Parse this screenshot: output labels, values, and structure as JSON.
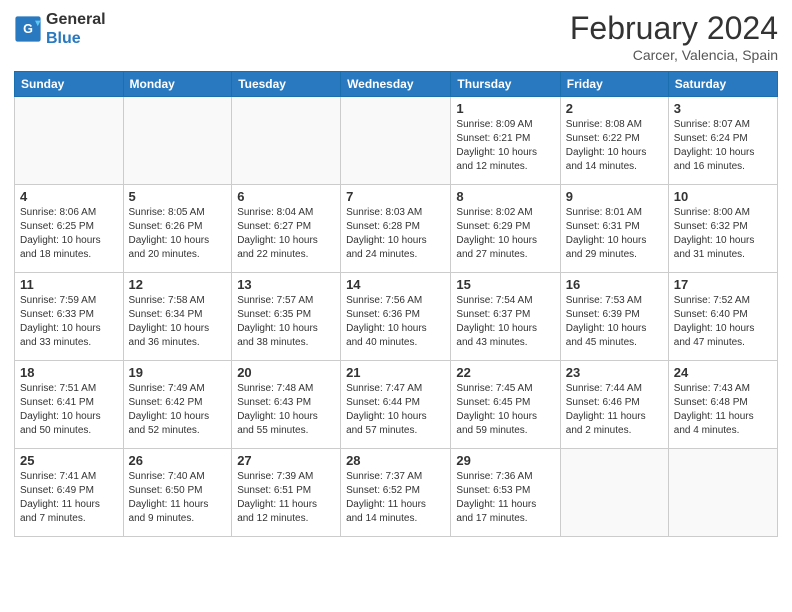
{
  "header": {
    "logo_line1": "General",
    "logo_line2": "Blue",
    "title": "February 2024",
    "subtitle": "Carcer, Valencia, Spain"
  },
  "days_of_week": [
    "Sunday",
    "Monday",
    "Tuesday",
    "Wednesday",
    "Thursday",
    "Friday",
    "Saturday"
  ],
  "weeks": [
    [
      {
        "day": "",
        "info": ""
      },
      {
        "day": "",
        "info": ""
      },
      {
        "day": "",
        "info": ""
      },
      {
        "day": "",
        "info": ""
      },
      {
        "day": "1",
        "info": "Sunrise: 8:09 AM\nSunset: 6:21 PM\nDaylight: 10 hours\nand 12 minutes."
      },
      {
        "day": "2",
        "info": "Sunrise: 8:08 AM\nSunset: 6:22 PM\nDaylight: 10 hours\nand 14 minutes."
      },
      {
        "day": "3",
        "info": "Sunrise: 8:07 AM\nSunset: 6:24 PM\nDaylight: 10 hours\nand 16 minutes."
      }
    ],
    [
      {
        "day": "4",
        "info": "Sunrise: 8:06 AM\nSunset: 6:25 PM\nDaylight: 10 hours\nand 18 minutes."
      },
      {
        "day": "5",
        "info": "Sunrise: 8:05 AM\nSunset: 6:26 PM\nDaylight: 10 hours\nand 20 minutes."
      },
      {
        "day": "6",
        "info": "Sunrise: 8:04 AM\nSunset: 6:27 PM\nDaylight: 10 hours\nand 22 minutes."
      },
      {
        "day": "7",
        "info": "Sunrise: 8:03 AM\nSunset: 6:28 PM\nDaylight: 10 hours\nand 24 minutes."
      },
      {
        "day": "8",
        "info": "Sunrise: 8:02 AM\nSunset: 6:29 PM\nDaylight: 10 hours\nand 27 minutes."
      },
      {
        "day": "9",
        "info": "Sunrise: 8:01 AM\nSunset: 6:31 PM\nDaylight: 10 hours\nand 29 minutes."
      },
      {
        "day": "10",
        "info": "Sunrise: 8:00 AM\nSunset: 6:32 PM\nDaylight: 10 hours\nand 31 minutes."
      }
    ],
    [
      {
        "day": "11",
        "info": "Sunrise: 7:59 AM\nSunset: 6:33 PM\nDaylight: 10 hours\nand 33 minutes."
      },
      {
        "day": "12",
        "info": "Sunrise: 7:58 AM\nSunset: 6:34 PM\nDaylight: 10 hours\nand 36 minutes."
      },
      {
        "day": "13",
        "info": "Sunrise: 7:57 AM\nSunset: 6:35 PM\nDaylight: 10 hours\nand 38 minutes."
      },
      {
        "day": "14",
        "info": "Sunrise: 7:56 AM\nSunset: 6:36 PM\nDaylight: 10 hours\nand 40 minutes."
      },
      {
        "day": "15",
        "info": "Sunrise: 7:54 AM\nSunset: 6:37 PM\nDaylight: 10 hours\nand 43 minutes."
      },
      {
        "day": "16",
        "info": "Sunrise: 7:53 AM\nSunset: 6:39 PM\nDaylight: 10 hours\nand 45 minutes."
      },
      {
        "day": "17",
        "info": "Sunrise: 7:52 AM\nSunset: 6:40 PM\nDaylight: 10 hours\nand 47 minutes."
      }
    ],
    [
      {
        "day": "18",
        "info": "Sunrise: 7:51 AM\nSunset: 6:41 PM\nDaylight: 10 hours\nand 50 minutes."
      },
      {
        "day": "19",
        "info": "Sunrise: 7:49 AM\nSunset: 6:42 PM\nDaylight: 10 hours\nand 52 minutes."
      },
      {
        "day": "20",
        "info": "Sunrise: 7:48 AM\nSunset: 6:43 PM\nDaylight: 10 hours\nand 55 minutes."
      },
      {
        "day": "21",
        "info": "Sunrise: 7:47 AM\nSunset: 6:44 PM\nDaylight: 10 hours\nand 57 minutes."
      },
      {
        "day": "22",
        "info": "Sunrise: 7:45 AM\nSunset: 6:45 PM\nDaylight: 10 hours\nand 59 minutes."
      },
      {
        "day": "23",
        "info": "Sunrise: 7:44 AM\nSunset: 6:46 PM\nDaylight: 11 hours\nand 2 minutes."
      },
      {
        "day": "24",
        "info": "Sunrise: 7:43 AM\nSunset: 6:48 PM\nDaylight: 11 hours\nand 4 minutes."
      }
    ],
    [
      {
        "day": "25",
        "info": "Sunrise: 7:41 AM\nSunset: 6:49 PM\nDaylight: 11 hours\nand 7 minutes."
      },
      {
        "day": "26",
        "info": "Sunrise: 7:40 AM\nSunset: 6:50 PM\nDaylight: 11 hours\nand 9 minutes."
      },
      {
        "day": "27",
        "info": "Sunrise: 7:39 AM\nSunset: 6:51 PM\nDaylight: 11 hours\nand 12 minutes."
      },
      {
        "day": "28",
        "info": "Sunrise: 7:37 AM\nSunset: 6:52 PM\nDaylight: 11 hours\nand 14 minutes."
      },
      {
        "day": "29",
        "info": "Sunrise: 7:36 AM\nSunset: 6:53 PM\nDaylight: 11 hours\nand 17 minutes."
      },
      {
        "day": "",
        "info": ""
      },
      {
        "day": "",
        "info": ""
      }
    ]
  ]
}
